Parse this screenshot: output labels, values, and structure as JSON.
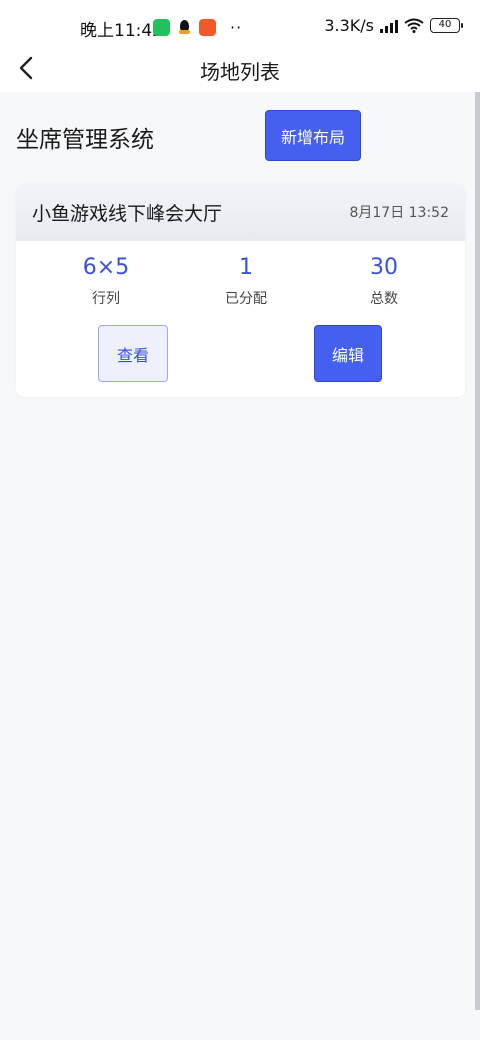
{
  "status_bar": {
    "time": "晚上11:42",
    "dots": "··",
    "network_speed": "3.3K/s",
    "battery": "40"
  },
  "nav": {
    "title": "场地列表"
  },
  "main": {
    "heading": "坐席管理系统",
    "add_button_label": "新增布局"
  },
  "venues": [
    {
      "name": "小鱼游戏线下峰会大厅",
      "datetime": "8月17日 13:52",
      "stats": [
        {
          "value": "6×5",
          "label": "行列"
        },
        {
          "value": "1",
          "label": "已分配"
        },
        {
          "value": "30",
          "label": "总数"
        }
      ],
      "view_label": "查看",
      "edit_label": "编辑"
    }
  ],
  "colors": {
    "primary": "#4560ee",
    "accent_text": "#3650e0",
    "page_bg": "#f7f8fa"
  }
}
